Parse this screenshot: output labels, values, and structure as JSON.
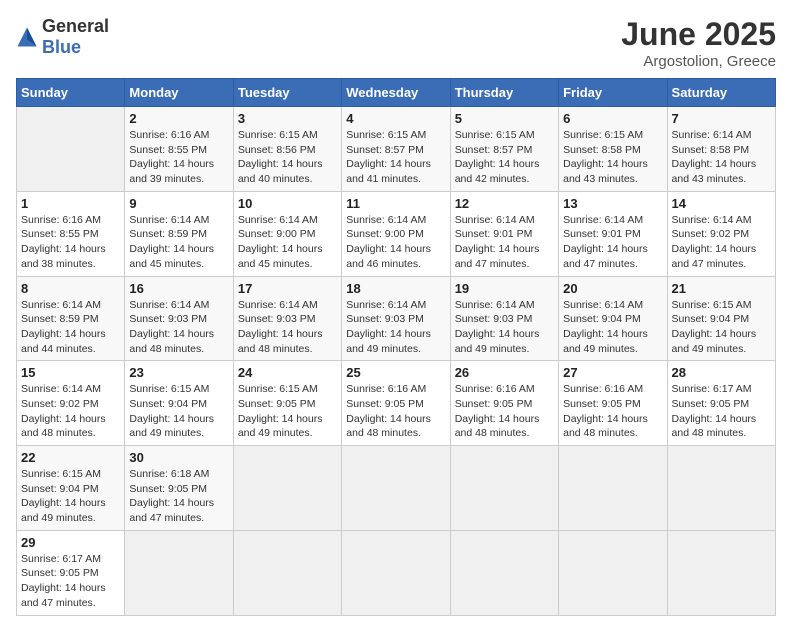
{
  "header": {
    "logo_general": "General",
    "logo_blue": "Blue",
    "title": "June 2025",
    "subtitle": "Argostolion, Greece"
  },
  "calendar": {
    "days_of_week": [
      "Sunday",
      "Monday",
      "Tuesday",
      "Wednesday",
      "Thursday",
      "Friday",
      "Saturday"
    ],
    "weeks": [
      [
        {
          "day": null
        },
        {
          "day": "2",
          "sunrise": "6:16 AM",
          "sunset": "8:55 PM",
          "daylight": "14 hours and 39 minutes."
        },
        {
          "day": "3",
          "sunrise": "6:15 AM",
          "sunset": "8:56 PM",
          "daylight": "14 hours and 40 minutes."
        },
        {
          "day": "4",
          "sunrise": "6:15 AM",
          "sunset": "8:57 PM",
          "daylight": "14 hours and 41 minutes."
        },
        {
          "day": "5",
          "sunrise": "6:15 AM",
          "sunset": "8:57 PM",
          "daylight": "14 hours and 42 minutes."
        },
        {
          "day": "6",
          "sunrise": "6:15 AM",
          "sunset": "8:58 PM",
          "daylight": "14 hours and 43 minutes."
        },
        {
          "day": "7",
          "sunrise": "6:14 AM",
          "sunset": "8:58 PM",
          "daylight": "14 hours and 43 minutes."
        }
      ],
      [
        {
          "day": "1",
          "sunrise": "6:16 AM",
          "sunset": "8:55 PM",
          "daylight": "14 hours and 38 minutes."
        },
        {
          "day": "9",
          "sunrise": "6:14 AM",
          "sunset": "8:59 PM",
          "daylight": "14 hours and 45 minutes."
        },
        {
          "day": "10",
          "sunrise": "6:14 AM",
          "sunset": "9:00 PM",
          "daylight": "14 hours and 45 minutes."
        },
        {
          "day": "11",
          "sunrise": "6:14 AM",
          "sunset": "9:00 PM",
          "daylight": "14 hours and 46 minutes."
        },
        {
          "day": "12",
          "sunrise": "6:14 AM",
          "sunset": "9:01 PM",
          "daylight": "14 hours and 47 minutes."
        },
        {
          "day": "13",
          "sunrise": "6:14 AM",
          "sunset": "9:01 PM",
          "daylight": "14 hours and 47 minutes."
        },
        {
          "day": "14",
          "sunrise": "6:14 AM",
          "sunset": "9:02 PM",
          "daylight": "14 hours and 47 minutes."
        }
      ],
      [
        {
          "day": "8",
          "sunrise": "6:14 AM",
          "sunset": "8:59 PM",
          "daylight": "14 hours and 44 minutes."
        },
        {
          "day": "16",
          "sunrise": "6:14 AM",
          "sunset": "9:03 PM",
          "daylight": "14 hours and 48 minutes."
        },
        {
          "day": "17",
          "sunrise": "6:14 AM",
          "sunset": "9:03 PM",
          "daylight": "14 hours and 48 minutes."
        },
        {
          "day": "18",
          "sunrise": "6:14 AM",
          "sunset": "9:03 PM",
          "daylight": "14 hours and 49 minutes."
        },
        {
          "day": "19",
          "sunrise": "6:14 AM",
          "sunset": "9:03 PM",
          "daylight": "14 hours and 49 minutes."
        },
        {
          "day": "20",
          "sunrise": "6:14 AM",
          "sunset": "9:04 PM",
          "daylight": "14 hours and 49 minutes."
        },
        {
          "day": "21",
          "sunrise": "6:15 AM",
          "sunset": "9:04 PM",
          "daylight": "14 hours and 49 minutes."
        }
      ],
      [
        {
          "day": "15",
          "sunrise": "6:14 AM",
          "sunset": "9:02 PM",
          "daylight": "14 hours and 48 minutes."
        },
        {
          "day": "23",
          "sunrise": "6:15 AM",
          "sunset": "9:04 PM",
          "daylight": "14 hours and 49 minutes."
        },
        {
          "day": "24",
          "sunrise": "6:15 AM",
          "sunset": "9:05 PM",
          "daylight": "14 hours and 49 minutes."
        },
        {
          "day": "25",
          "sunrise": "6:16 AM",
          "sunset": "9:05 PM",
          "daylight": "14 hours and 48 minutes."
        },
        {
          "day": "26",
          "sunrise": "6:16 AM",
          "sunset": "9:05 PM",
          "daylight": "14 hours and 48 minutes."
        },
        {
          "day": "27",
          "sunrise": "6:16 AM",
          "sunset": "9:05 PM",
          "daylight": "14 hours and 48 minutes."
        },
        {
          "day": "28",
          "sunrise": "6:17 AM",
          "sunset": "9:05 PM",
          "daylight": "14 hours and 48 minutes."
        }
      ],
      [
        {
          "day": "22",
          "sunrise": "6:15 AM",
          "sunset": "9:04 PM",
          "daylight": "14 hours and 49 minutes."
        },
        {
          "day": "30",
          "sunrise": "6:18 AM",
          "sunset": "9:05 PM",
          "daylight": "14 hours and 47 minutes."
        },
        {
          "day": null
        },
        {
          "day": null
        },
        {
          "day": null
        },
        {
          "day": null
        },
        {
          "day": null
        }
      ],
      [
        {
          "day": "29",
          "sunrise": "6:17 AM",
          "sunset": "9:05 PM",
          "daylight": "14 hours and 47 minutes."
        },
        {
          "day": null
        },
        {
          "day": null
        },
        {
          "day": null
        },
        {
          "day": null
        },
        {
          "day": null
        },
        {
          "day": null
        }
      ]
    ]
  }
}
